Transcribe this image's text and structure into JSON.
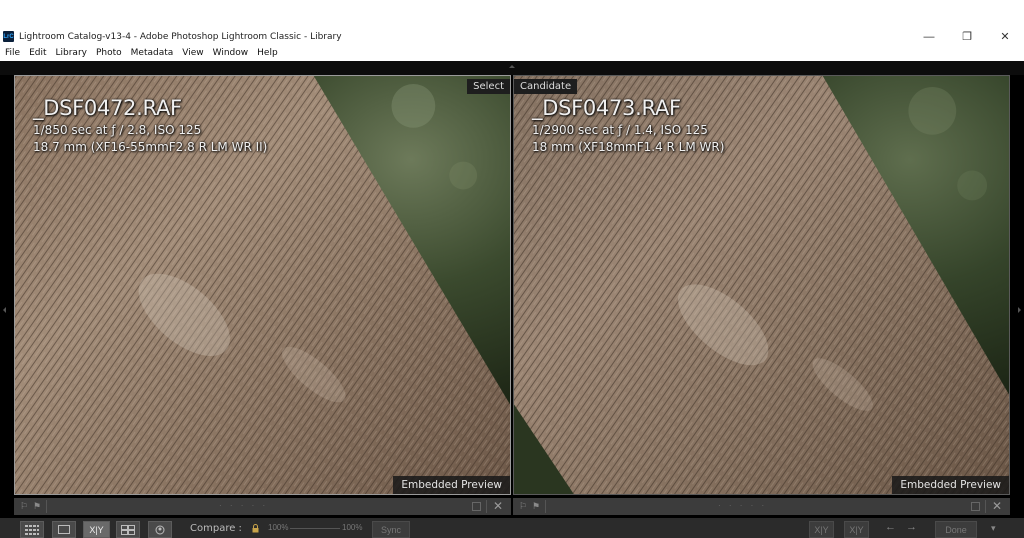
{
  "window": {
    "title": "Lightroom Catalog-v13-4 - Adobe Photoshop Lightroom Classic - Library",
    "icon": "LrC",
    "controls": {
      "minimize": "—",
      "restore": "❐",
      "close": "✕"
    }
  },
  "menu": [
    "File",
    "Edit",
    "Library",
    "Photo",
    "Metadata",
    "View",
    "Window",
    "Help"
  ],
  "compare": {
    "select": {
      "tag": "Select",
      "filename": "_DSF0472.RAF",
      "exposure": "1/850 sec at ƒ / 2.8, ISO 125",
      "lens": "18.7 mm (XF16-55mmF2.8 R LM WR II)",
      "preview": "Embedded Preview"
    },
    "candidate": {
      "tag": "Candidate",
      "filename": "_DSF0473.RAF",
      "exposure": "1/2900 sec at ƒ / 1.4, ISO 125",
      "lens": "18 mm (XF18mmF1.4 R LM WR)",
      "preview": "Embedded Preview"
    }
  },
  "toolbar": {
    "compare_label": "Compare :",
    "zoom_left": "100%",
    "zoom_right": "100%",
    "sync": "Sync",
    "swap_xy": "X|Y",
    "done": "Done",
    "xy_label": "X|Y"
  },
  "colors": {
    "bg": "#000000",
    "panel_bar": "#3c3c3c",
    "toolbar": "#2b2b2b",
    "bark_light": "#9c8470",
    "bark_dark": "#4a3a2e",
    "foliage": "#2f3b26"
  }
}
